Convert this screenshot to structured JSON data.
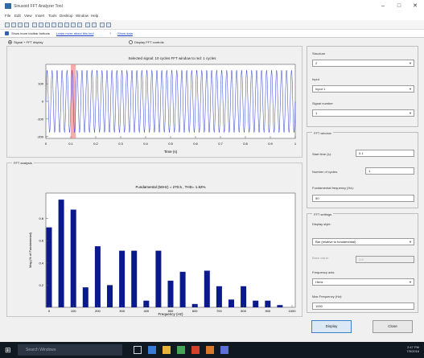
{
  "window": {
    "title": "Sinusoid FFT Analyzer Tool",
    "minimize": "–",
    "maximize": "□",
    "close": "✕"
  },
  "menu": [
    "File",
    "Edit",
    "View",
    "Insert",
    "Tools",
    "Desktop",
    "Window",
    "Help"
  ],
  "hint": {
    "text": "Show more toolbar buttons",
    "link1": "Learn more about this tool",
    "link2": "Show data"
  },
  "modes": {
    "option1": "Signal + FFT display",
    "option2": "Display FFT controls",
    "option1_selected": true
  },
  "signal_panel": {
    "title": "Selected signal: 10 cycles  FFT window to red: 1 cycles",
    "xlabel": "Time (s)",
    "ylabel": "",
    "yticks": [
      "100",
      "0",
      "-100",
      "-200"
    ],
    "xticks": [
      "0",
      "0.1",
      "0.2",
      "0.3",
      "0.4",
      "0.5",
      "0.6",
      "0.7",
      "0.8",
      "0.9",
      "1"
    ],
    "colors": {
      "wave": "#2a3bd0",
      "highlight": "#f08a8a",
      "bg": "#ffffff"
    }
  },
  "fft_panel": {
    "label": "FFT analysis"
  },
  "chart_data": {
    "type": "bar",
    "title": "Fundamental (50Hz) = 270.5 , THD= 1.82%",
    "xlabel": "Frequency (Hz)",
    "ylabel": "Mag (% of Fundamental)",
    "x": [
      0,
      50,
      100,
      150,
      200,
      250,
      300,
      350,
      400,
      450,
      500,
      550,
      600,
      650,
      700,
      750,
      800,
      850,
      900,
      950,
      1000
    ],
    "x_bars": [
      0,
      25,
      50,
      75,
      100,
      125,
      150,
      175,
      200,
      225,
      250,
      275,
      300,
      325,
      350,
      375,
      400,
      425,
      450,
      475,
      500,
      525,
      550,
      575,
      600,
      625,
      650,
      675,
      700,
      725,
      750,
      775,
      800,
      825,
      850,
      875,
      900,
      925
    ],
    "note": "",
    "series": [
      {
        "x": [
          0,
          50,
          100,
          150,
          200,
          250,
          300,
          350,
          400,
          450,
          500,
          550,
          600,
          650,
          700,
          750,
          800,
          850,
          900,
          950
        ],
        "values": [
          0.72,
          0.97,
          0.88,
          0.18,
          0.55,
          0.2,
          0.51,
          0.51,
          0.06,
          0.51,
          0.24,
          0.32,
          0.03,
          0.33,
          0.19,
          0.07,
          0.19,
          0.06,
          0.06,
          0.02
        ]
      }
    ],
    "xlim": [
      0,
      1000
    ],
    "ylim": [
      0,
      1.0
    ],
    "xticks": [
      "0",
      "50",
      "100",
      "150",
      "200",
      "250",
      "300",
      "350",
      "400",
      "450",
      "500",
      "550",
      "600",
      "650",
      "700",
      "750",
      "800",
      "850",
      "900",
      "950",
      "1000"
    ],
    "yticks": [
      "0.8",
      "0.6",
      "0.4",
      "0.2"
    ],
    "grid": false,
    "color": "#0a1a8c"
  },
  "right": {
    "signal_group": {
      "label1": "Structure",
      "value1": "2",
      "label2": "Input",
      "value2": "Input 1",
      "label3": "Signal number",
      "value3": "1"
    },
    "fft_window_group": {
      "title": "FFT window",
      "start_label": "Start time (s):",
      "start_value": "0.1",
      "cycles_label": "Number of cycles:",
      "cycles_value": "1",
      "fund_label": "Fundamental frequency (Hz):",
      "fund_value": "50"
    },
    "fft_settings_group": {
      "title": "FFT settings",
      "display_label": "Display style:",
      "display_value": "Bar (relative to fundamental)",
      "base_label": "Base value:",
      "base_value": "1.0",
      "freq_axis_label": "Frequency axis:",
      "freq_axis_value": "Hertz",
      "max_label": "Max Frequency (Hz):",
      "max_value": "1000"
    },
    "display_button": "Display",
    "close_button": "Close"
  },
  "taskbar": {
    "search": "Search Windows",
    "time": "2:47 PM",
    "date": "7/5/2016"
  }
}
